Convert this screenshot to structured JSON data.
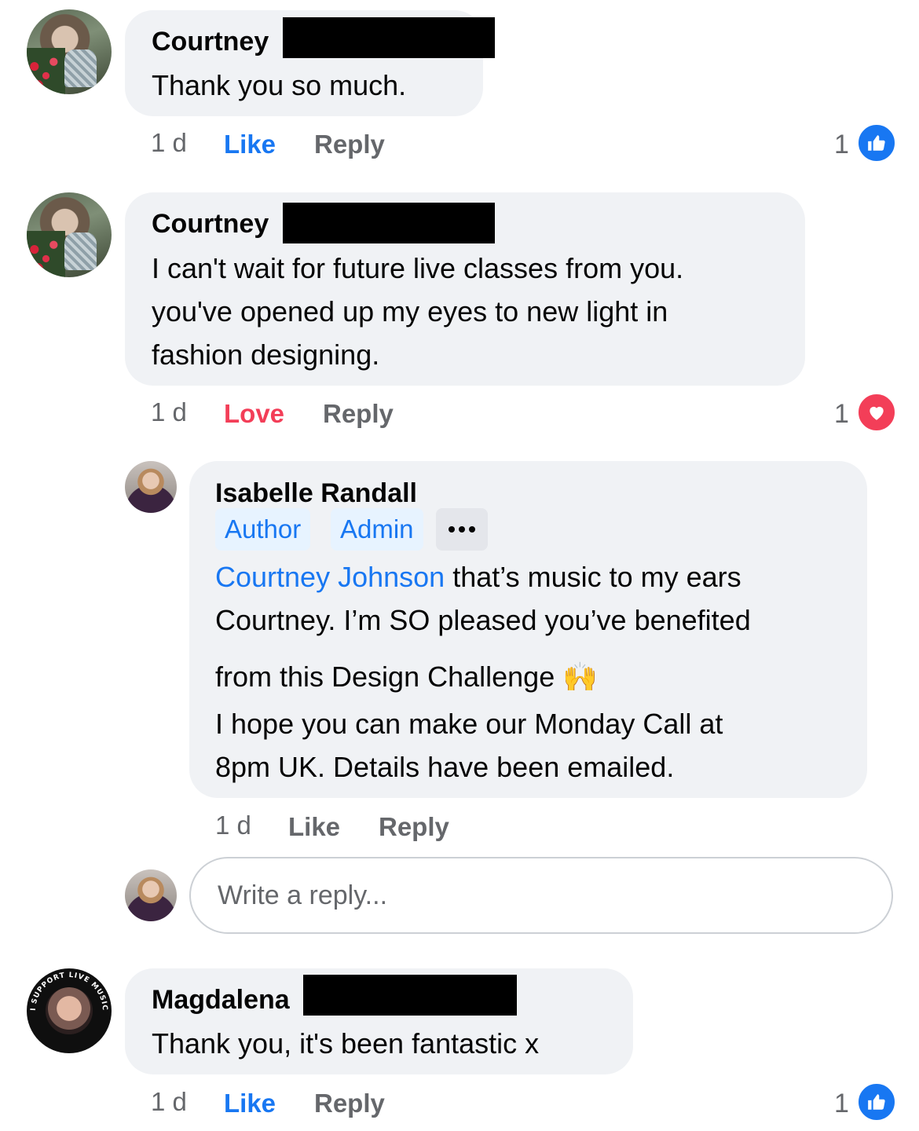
{
  "comments": [
    {
      "author": "Courtney",
      "text": "Thank you so much.",
      "time": "1 d",
      "reaction_action": "Like",
      "reply_label": "Reply",
      "reaction_count": "1",
      "reaction_icon": "like-icon"
    },
    {
      "author": "Courtney",
      "text_lines": [
        "I can't wait for future live classes from you.",
        "you've opened up my eyes to new light in",
        "fashion designing."
      ],
      "time": "1 d",
      "reaction_action": "Love",
      "reply_label": "Reply",
      "reaction_count": "1",
      "reaction_icon": "love-icon"
    }
  ],
  "reply": {
    "author": "Isabelle Randall",
    "badges": [
      "Author",
      "Admin"
    ],
    "more_icon": "more-dots-icon",
    "mention": "Courtney Johnson",
    "line1_rest": " that’s music to my ears",
    "line2": "Courtney. I’m SO pleased you’ve benefited",
    "line3": "from this Design Challenge",
    "emoji": "🙌",
    "line4": "I hope you can make our Monday Call at",
    "line5": "8pm UK. Details have been emailed.",
    "time": "1 d",
    "like_label": "Like",
    "reply_label": "Reply"
  },
  "reply_box": {
    "placeholder": "Write a reply..."
  },
  "comment3": {
    "author": "Magdalena",
    "text": "Thank you, it's been fantastic x",
    "time": "1 d",
    "reaction_action": "Like",
    "reply_label": "Reply",
    "reaction_count": "1",
    "reaction_icon": "like-icon",
    "avatar_ring_text": "I SUPPORT LIVE MUSIC"
  },
  "colors": {
    "like_blue": "#1877f2",
    "love_red": "#f33e58",
    "bubble_bg": "#f0f2f5",
    "meta_gray": "#65676b"
  }
}
